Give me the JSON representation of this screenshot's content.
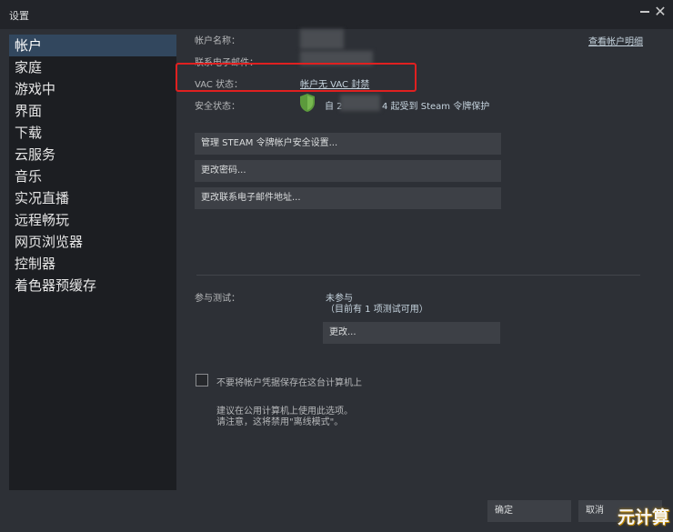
{
  "window": {
    "title": "设置"
  },
  "sidebar": {
    "items": [
      {
        "label": "帐户",
        "active": true
      },
      {
        "label": "家庭"
      },
      {
        "label": "游戏中"
      },
      {
        "label": "界面"
      },
      {
        "label": "下载"
      },
      {
        "label": "云服务"
      },
      {
        "label": "音乐"
      },
      {
        "label": "实况直播"
      },
      {
        "label": "远程畅玩"
      },
      {
        "label": "网页浏览器"
      },
      {
        "label": "控制器"
      },
      {
        "label": "着色器预缓存"
      }
    ]
  },
  "account": {
    "name_label": "帐户名称：",
    "email_label": "联系电子邮件：",
    "view_details_link": "查看帐户明细",
    "vac_label": "VAC 状态：",
    "vac_value": "帐户无 VAC 封禁",
    "security_label": "安全状态：",
    "security_prefix": "自 2",
    "security_suffix": "4 起受到 Steam 令牌保护"
  },
  "buttons": {
    "manage_guard": "管理 STEAM 令牌帐户安全设置...",
    "change_password": "更改密码...",
    "change_email": "更改联系电子邮件地址..."
  },
  "beta": {
    "label": "参与测试：",
    "status": "未参与",
    "available": "（目前有 1 项测试可用）",
    "change_button": "更改..."
  },
  "credentials": {
    "checkbox_label": "不要将帐户凭据保存在这台计算机上",
    "note_line1": "建议在公用计算机上使用此选项。",
    "note_line2": "请注意，这将禁用\"离线模式\"。"
  },
  "footer": {
    "ok": "确定",
    "cancel": "取消"
  },
  "watermark": "元计算",
  "colors": {
    "highlight_box": "#e02020",
    "active_item": "#32475e",
    "shield": "#5c9a3c"
  }
}
